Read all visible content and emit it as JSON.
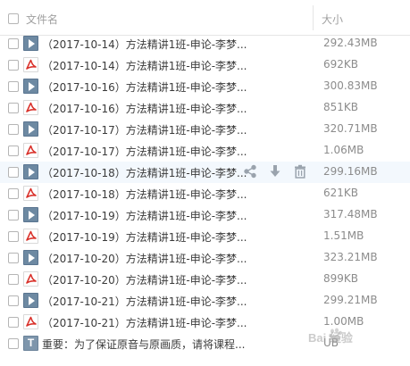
{
  "header": {
    "name_label": "文件名",
    "size_label": "大小"
  },
  "rows": [
    {
      "name": "（2017-10-14）方法精讲1班-申论-李梦...",
      "size": "292.43MB",
      "type": "video"
    },
    {
      "name": "（2017-10-14）方法精讲1班-申论-李梦...",
      "size": "692KB",
      "type": "pdf"
    },
    {
      "name": "（2017-10-16）方法精讲1班-申论-李梦...",
      "size": "300.83MB",
      "type": "video"
    },
    {
      "name": "（2017-10-16）方法精讲1班-申论-李梦...",
      "size": "851KB",
      "type": "pdf"
    },
    {
      "name": "（2017-10-17）方法精讲1班-申论-李梦...",
      "size": "320.71MB",
      "type": "video"
    },
    {
      "name": "（2017-10-17）方法精讲1班-申论-李梦...",
      "size": "1.06MB",
      "type": "pdf"
    },
    {
      "name": "（2017-10-18）方法精讲1班-申论-李梦...",
      "size": "299.16MB",
      "type": "video"
    },
    {
      "name": "（2017-10-18）方法精讲1班-申论-李梦...",
      "size": "621KB",
      "type": "pdf"
    },
    {
      "name": "（2017-10-19）方法精讲1班-申论-李梦...",
      "size": "317.48MB",
      "type": "video"
    },
    {
      "name": "（2017-10-19）方法精讲1班-申论-李梦...",
      "size": "1.51MB",
      "type": "pdf"
    },
    {
      "name": "（2017-10-20）方法精讲1班-申论-李梦...",
      "size": "323.21MB",
      "type": "video"
    },
    {
      "name": "（2017-10-20）方法精讲1班-申论-李梦...",
      "size": "899KB",
      "type": "pdf"
    },
    {
      "name": "（2017-10-21）方法精讲1班-申论-李梦...",
      "size": "299.21MB",
      "type": "video"
    },
    {
      "name": "（2017-10-21）方法精讲1班-申论-李梦...",
      "size": "1.00MB",
      "type": "pdf"
    },
    {
      "name": "重要：为了保证原音与原画质，请将课程...",
      "size": "UB",
      "type": "txt"
    }
  ],
  "watermark": {
    "text": "Bai 经验"
  },
  "colors": {
    "pdf_red": "#d9322b",
    "video_blue": "#6d89a2",
    "hover_bg": "#f3f8fd"
  }
}
